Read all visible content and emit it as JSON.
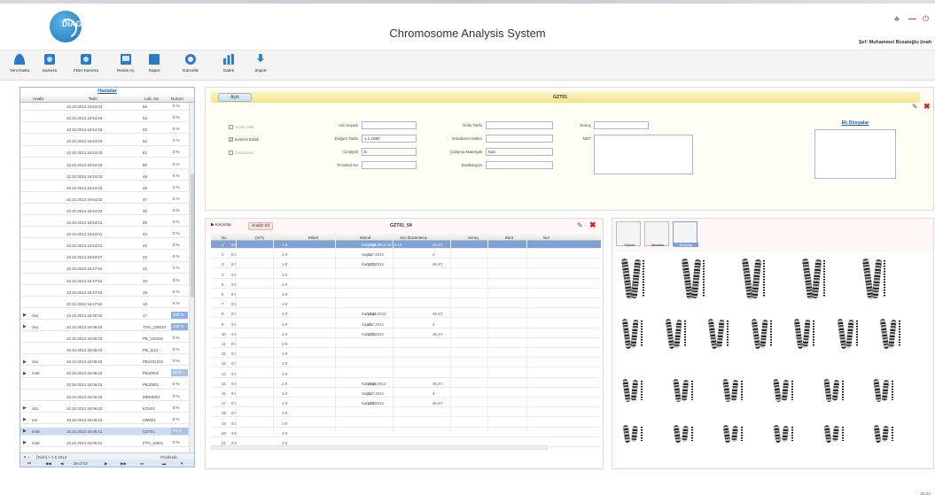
{
  "header": {
    "logo_text": "DiAGEN",
    "title": "Chromosome Analysis System",
    "user_line": "Şef: Muhammet Bozatoğlu (mah",
    "icons": [
      "user-settings-icon",
      "minimize-icon",
      "power-icon"
    ]
  },
  "toolbar": [
    {
      "label": "Yeni Hasta",
      "icon": "add-person-icon"
    },
    {
      "label": "Kamera",
      "icon": "camera-icon"
    },
    {
      "label": "FISH Kamera",
      "icon": "fish-camera-icon"
    },
    {
      "label": "Resim Aç",
      "icon": "open-image-icon"
    },
    {
      "label": "Rapor",
      "icon": "report-icon"
    },
    {
      "label": "Güncelle",
      "icon": "update-icon"
    },
    {
      "label": "Galeri",
      "icon": "gallery-icon"
    },
    {
      "label": "Import",
      "icon": "import-icon"
    }
  ],
  "patients": {
    "title": "Hastalar",
    "columns": [
      "Analiz",
      "Tarih",
      "Lab. No",
      "Durum"
    ],
    "rows": [
      {
        "arrow": "",
        "analiz": "",
        "tarih": "10.10.2013 16:54:04",
        "lab": "55",
        "durum": "0 %"
      },
      {
        "arrow": "",
        "analiz": "",
        "tarih": "10.10.2013 16:54:04",
        "lab": "54",
        "durum": "0 %"
      },
      {
        "arrow": "",
        "analiz": "",
        "tarih": "10.10.2013 16:54:03",
        "lab": "53",
        "durum": "0 %"
      },
      {
        "arrow": "",
        "analiz": "",
        "tarih": "10.10.2013 16:54:03",
        "lab": "52",
        "durum": "0 %"
      },
      {
        "arrow": "",
        "analiz": "",
        "tarih": "10.10.2013 16:54:03",
        "lab": "51",
        "durum": "0 %"
      },
      {
        "arrow": "",
        "analiz": "",
        "tarih": "10.10.2013 16:54:03",
        "lab": "50",
        "durum": "0 %"
      },
      {
        "arrow": "",
        "analiz": "",
        "tarih": "10.10.2013 16:54:03",
        "lab": "49",
        "durum": "0 %"
      },
      {
        "arrow": "",
        "analiz": "",
        "tarih": "10.10.2013 16:54:02",
        "lab": "48",
        "durum": "0 %"
      },
      {
        "arrow": "",
        "analiz": "",
        "tarih": "10.10.2013 16:54:02",
        "lab": "47",
        "durum": "0 %"
      },
      {
        "arrow": "",
        "analiz": "",
        "tarih": "10.10.2013 16:54:02",
        "lab": "46",
        "durum": "0 %"
      },
      {
        "arrow": "",
        "analiz": "",
        "tarih": "10.10.2013 16:54:01",
        "lab": "45",
        "durum": "0 %"
      },
      {
        "arrow": "",
        "analiz": "",
        "tarih": "10.10.2013 16:54:01",
        "lab": "44",
        "durum": "0 %"
      },
      {
        "arrow": "",
        "analiz": "",
        "tarih": "10.10.2013 16:54:01",
        "lab": "43",
        "durum": "0 %"
      },
      {
        "arrow": "",
        "analiz": "",
        "tarih": "10.10.2013 16:53:57",
        "lab": "22",
        "durum": "0 %"
      },
      {
        "arrow": "",
        "analiz": "",
        "tarih": "10.10.2013 16:47:54",
        "lab": "21",
        "durum": "0 %"
      },
      {
        "arrow": "",
        "analiz": "",
        "tarih": "10.10.2013 16:47:54",
        "lab": "20",
        "durum": "0 %"
      },
      {
        "arrow": "",
        "analiz": "",
        "tarih": "10.10.2013 16:47:53",
        "lab": "19",
        "durum": "0 %"
      },
      {
        "arrow": "",
        "analiz": "",
        "tarih": "10.10.2013 16:47:52",
        "lab": "18",
        "durum": "0 %"
      },
      {
        "arrow": "▶",
        "analiz": "cka",
        "tarih": "10.10.2013 16:30:32",
        "lab": "17",
        "durum": "100 %"
      },
      {
        "arrow": "▶",
        "analiz": "cka",
        "tarih": "10.10.2013 16:06:42",
        "lab": "TOU_100023",
        "durum": "100 %"
      },
      {
        "arrow": "",
        "analiz": "",
        "tarih": "10.10.2013 16:06:42",
        "lab": "PB_120234",
        "durum": "0 %"
      },
      {
        "arrow": "",
        "analiz": "",
        "tarih": "10.10.2013 16:06:42",
        "lab": "PB_1112",
        "durum": "0 %"
      },
      {
        "arrow": "▶",
        "analiz": "cka",
        "tarih": "10.10.2013 16:06:42",
        "lab": "PB1231234",
        "durum": "0 %"
      },
      {
        "arrow": "▶",
        "analiz": "mnb",
        "tarih": "10.10.2013 16:06:42",
        "lab": "PB10002",
        "durum": "50 %"
      },
      {
        "arrow": "",
        "analiz": "",
        "tarih": "10.10.2013 16:06:42",
        "lab": "PB10001",
        "durum": "0 %"
      },
      {
        "arrow": "",
        "analiz": "",
        "tarih": "10.10.2013 16:06:42",
        "lab": "MDK0001",
        "durum": "0 %"
      },
      {
        "arrow": "▶",
        "analiz": "cka",
        "tarih": "10.10.2013 16:06:42",
        "lab": "KCK01",
        "durum": "0 %"
      },
      {
        "arrow": "▶",
        "analiz": "mn",
        "tarih": "10.10.2013 16:06:42",
        "lab": "IZM001",
        "durum": "0 %"
      },
      {
        "arrow": "▶",
        "analiz": "mnb",
        "tarih": "10.10.2013 16:06:41",
        "lab": "GZT01",
        "durum": "75 %"
      },
      {
        "arrow": "▶",
        "analiz": "mnb",
        "tarih": "10.10.2013 16:06:41",
        "lab": "FTH_10001",
        "durum": "0 %"
      }
    ],
    "filter_text": "[Tarih] > 1.6.2013",
    "filter_button": "Özelleştir...",
    "pager": "39 of 44"
  },
  "detail": {
    "tab": "Açık",
    "code": "GZT01",
    "checks": [
      {
        "label": "Analiz Bitti",
        "checked": true,
        "disabled": true
      },
      {
        "label": "Kontrol Edildi",
        "checked": true,
        "disabled": false
      },
      {
        "label": "Onaylandı",
        "checked": false,
        "disabled": true
      }
    ],
    "fields": {
      "ad_soyadi": {
        "label": "Adı Soyadı",
        "value": ""
      },
      "dogum_tarihi": {
        "label": "Doğum Tarihi",
        "value": "1.1.1980"
      },
      "cinsiyet": {
        "label": "Cinsiyeti",
        "value": "E"
      },
      "protokol": {
        "label": "Protokol No",
        "value": ""
      },
      "gelis_tarihi": {
        "label": "Geliş Tarihi",
        "value": ""
      },
      "gonderen": {
        "label": "Gönderen Hekim",
        "value": ""
      },
      "materyal": {
        "label": "Çalışma Materyali",
        "value": "Kan"
      },
      "endikasyon": {
        "label": "Endikasyon",
        "value": ""
      },
      "sonuc": {
        "label": "Sonuç",
        "value": ""
      },
      "not": {
        "label": "NOT",
        "value": ""
      }
    },
    "ek_dosyalar": "Ek Dosyalar"
  },
  "analysis": {
    "tabs": [
      "Karyotip",
      "Analiz Sil"
    ],
    "title": "GZT01_54",
    "columns": [
      "No",
      "(X/Y)",
      "Etiket",
      "Metod",
      "Son Düzenleme",
      "Sonuç",
      "Bant",
      "Not"
    ],
    "rows": [
      {
        "no": "1",
        "xy": "0:0",
        "etiket": "1-0",
        "metod": "Karyotip",
        "son": "11.10.2013 10:12:12",
        "sonuc": "46,XY"
      },
      {
        "no": "2",
        "xy": "0:0",
        "etiket": "1-0",
        "metod": "Sayım",
        "son": "11.7.2013",
        "sonuc": "4"
      },
      {
        "no": "3",
        "xy": "0:0",
        "etiket": "1-0",
        "metod": "Karyotip",
        "son": "11.7.2013",
        "sonuc": "46,XY"
      },
      {
        "no": "4",
        "xy": "0:0",
        "etiket": "1-0",
        "metod": "",
        "son": "",
        "sonuc": ""
      },
      {
        "no": "5",
        "xy": "0:0",
        "etiket": "1-0",
        "metod": "",
        "son": "",
        "sonuc": ""
      },
      {
        "no": "6",
        "xy": "0:0",
        "etiket": "1-0",
        "metod": "",
        "son": "",
        "sonuc": ""
      },
      {
        "no": "7",
        "xy": "0:0",
        "etiket": "1-0",
        "metod": "",
        "son": "",
        "sonuc": ""
      },
      {
        "no": "8",
        "xy": "0:0",
        "etiket": "1-0",
        "metod": "Karyotip",
        "son": "10.10.2013",
        "sonuc": "46,XY"
      },
      {
        "no": "9",
        "xy": "0:0",
        "etiket": "1-0",
        "metod": "Sayım",
        "son": "11.7.2013",
        "sonuc": "4"
      },
      {
        "no": "10",
        "xy": "0:0",
        "etiket": "1-0",
        "metod": "Karyotip",
        "son": "11.7.2013",
        "sonuc": "46,XY"
      },
      {
        "no": "11",
        "xy": "0:0",
        "etiket": "1-0",
        "metod": "",
        "son": "",
        "sonuc": ""
      },
      {
        "no": "12",
        "xy": "0:0",
        "etiket": "1-0",
        "metod": "",
        "son": "",
        "sonuc": ""
      },
      {
        "no": "13",
        "xy": "0:0",
        "etiket": "1-0",
        "metod": "",
        "son": "",
        "sonuc": ""
      },
      {
        "no": "14",
        "xy": "0:0",
        "etiket": "1-0",
        "metod": "",
        "son": "",
        "sonuc": ""
      },
      {
        "no": "15",
        "xy": "0:0",
        "etiket": "1-0",
        "metod": "Karyotip",
        "son": "10.10.2013",
        "sonuc": "46,XY"
      },
      {
        "no": "16",
        "xy": "0:0",
        "etiket": "1-0",
        "metod": "Sayım",
        "son": "11.7.2013",
        "sonuc": "4"
      },
      {
        "no": "17",
        "xy": "0:0",
        "etiket": "1-0",
        "metod": "Karyotip",
        "son": "11.7.2013",
        "sonuc": "46,XY"
      },
      {
        "no": "18",
        "xy": "0:0",
        "etiket": "1-0",
        "metod": "",
        "son": "",
        "sonuc": ""
      },
      {
        "no": "19",
        "xy": "0:0",
        "etiket": "1-0",
        "metod": "",
        "son": "",
        "sonuc": ""
      },
      {
        "no": "20",
        "xy": "0:0",
        "etiket": "1-0",
        "metod": "",
        "son": "",
        "sonuc": ""
      },
      {
        "no": "21",
        "xy": "0:0",
        "etiket": "1-0",
        "metod": "",
        "son": "",
        "sonuc": ""
      }
    ]
  },
  "karyogram": {
    "thumbs": [
      "Orjinal",
      "Metafaz",
      "Karyotip"
    ],
    "selected_thumb": "Karyotip"
  },
  "clock": "15:22",
  "colors": {
    "accent": "#2b7bc9",
    "selection": "#7ea2d6",
    "title_link": "#1f5fa8",
    "close": "#d42020"
  }
}
